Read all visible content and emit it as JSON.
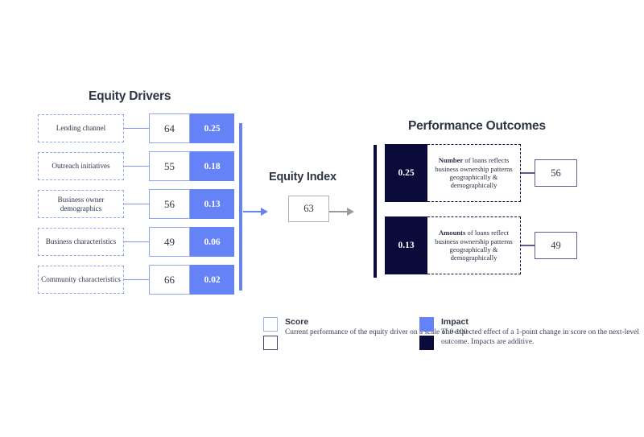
{
  "headings": {
    "drivers": "Equity Drivers",
    "index": "Equity Index",
    "outcomes": "Performance Outcomes"
  },
  "drivers": [
    {
      "label": "Lending channel",
      "score": "64",
      "impact": "0.25"
    },
    {
      "label": "Outreach initiatives",
      "score": "55",
      "impact": "0.18"
    },
    {
      "label": "Business owner demographics",
      "score": "56",
      "impact": "0.13"
    },
    {
      "label": "Business characteristics",
      "score": "49",
      "impact": "0.06"
    },
    {
      "label": "Community characteristics",
      "score": "66",
      "impact": "0.02"
    }
  ],
  "index": {
    "value": "63"
  },
  "outcomes": [
    {
      "impact": "0.25",
      "desc_bold": "Number",
      "desc_rest": " of loans reflects business ownership patterns geographically & demographically",
      "score": "56"
    },
    {
      "impact": "0.13",
      "desc_bold": "Amounts",
      "desc_rest": " of loans reflect business ownership patterns geographically & demographically",
      "score": "49"
    }
  ],
  "legend": {
    "score": {
      "title": "Score",
      "desc": "Current performance of the equity driver on a scale of 0-100"
    },
    "impact": {
      "title": "Impact",
      "desc": "The expected effect of a 1-point change in score on the next-level outcome. Impacts are additive."
    }
  },
  "colors": {
    "blue": "#6583f7",
    "navy": "#0b0b3b",
    "periwinkle": "#91a7f3",
    "gray_border": "#b0b0b0",
    "heading": "#2f3445"
  }
}
